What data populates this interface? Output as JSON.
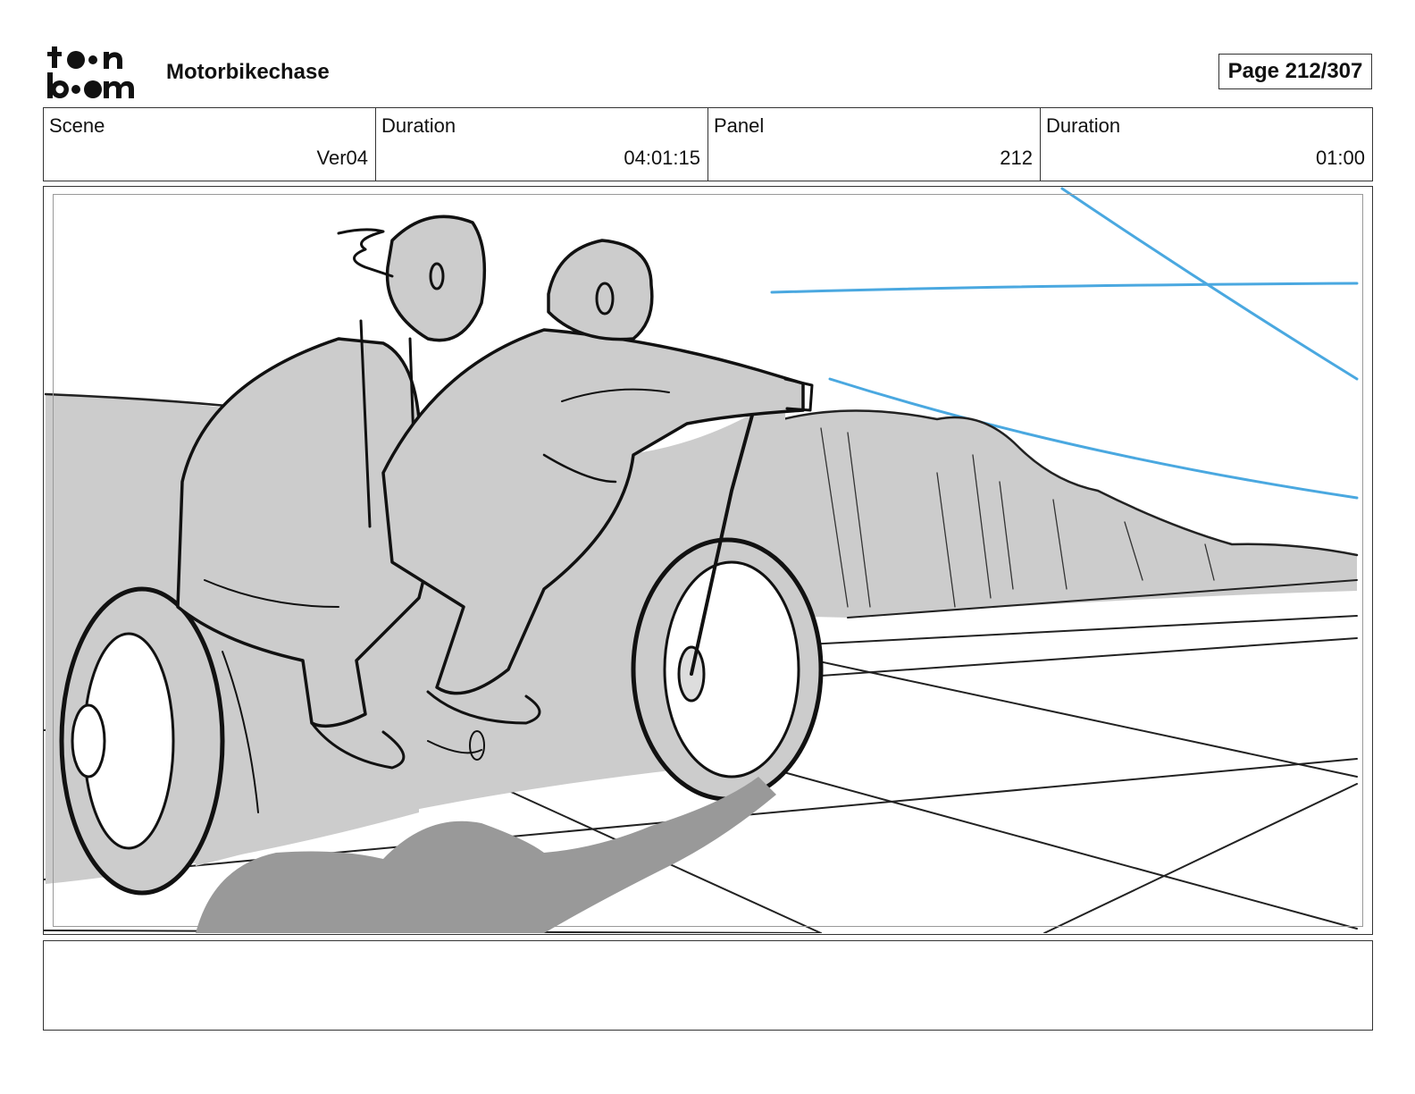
{
  "header": {
    "logo_text": "toon boom",
    "project_title": "Motorbikechase",
    "page_label": "Page 212/307"
  },
  "info": {
    "scene_label": "Scene",
    "scene_value": "Ver04",
    "scene_duration_label": "Duration",
    "scene_duration_value": "04:01:15",
    "panel_label": "Panel",
    "panel_value": "212",
    "panel_duration_label": "Duration",
    "panel_duration_value": "01:00"
  },
  "panel": {
    "description": "",
    "colors": {
      "ink": "#111111",
      "fill_gray": "#cccccc",
      "shadow_gray": "#999999",
      "guide_blue": "#4aa8e0"
    }
  },
  "notes": {
    "text": ""
  }
}
